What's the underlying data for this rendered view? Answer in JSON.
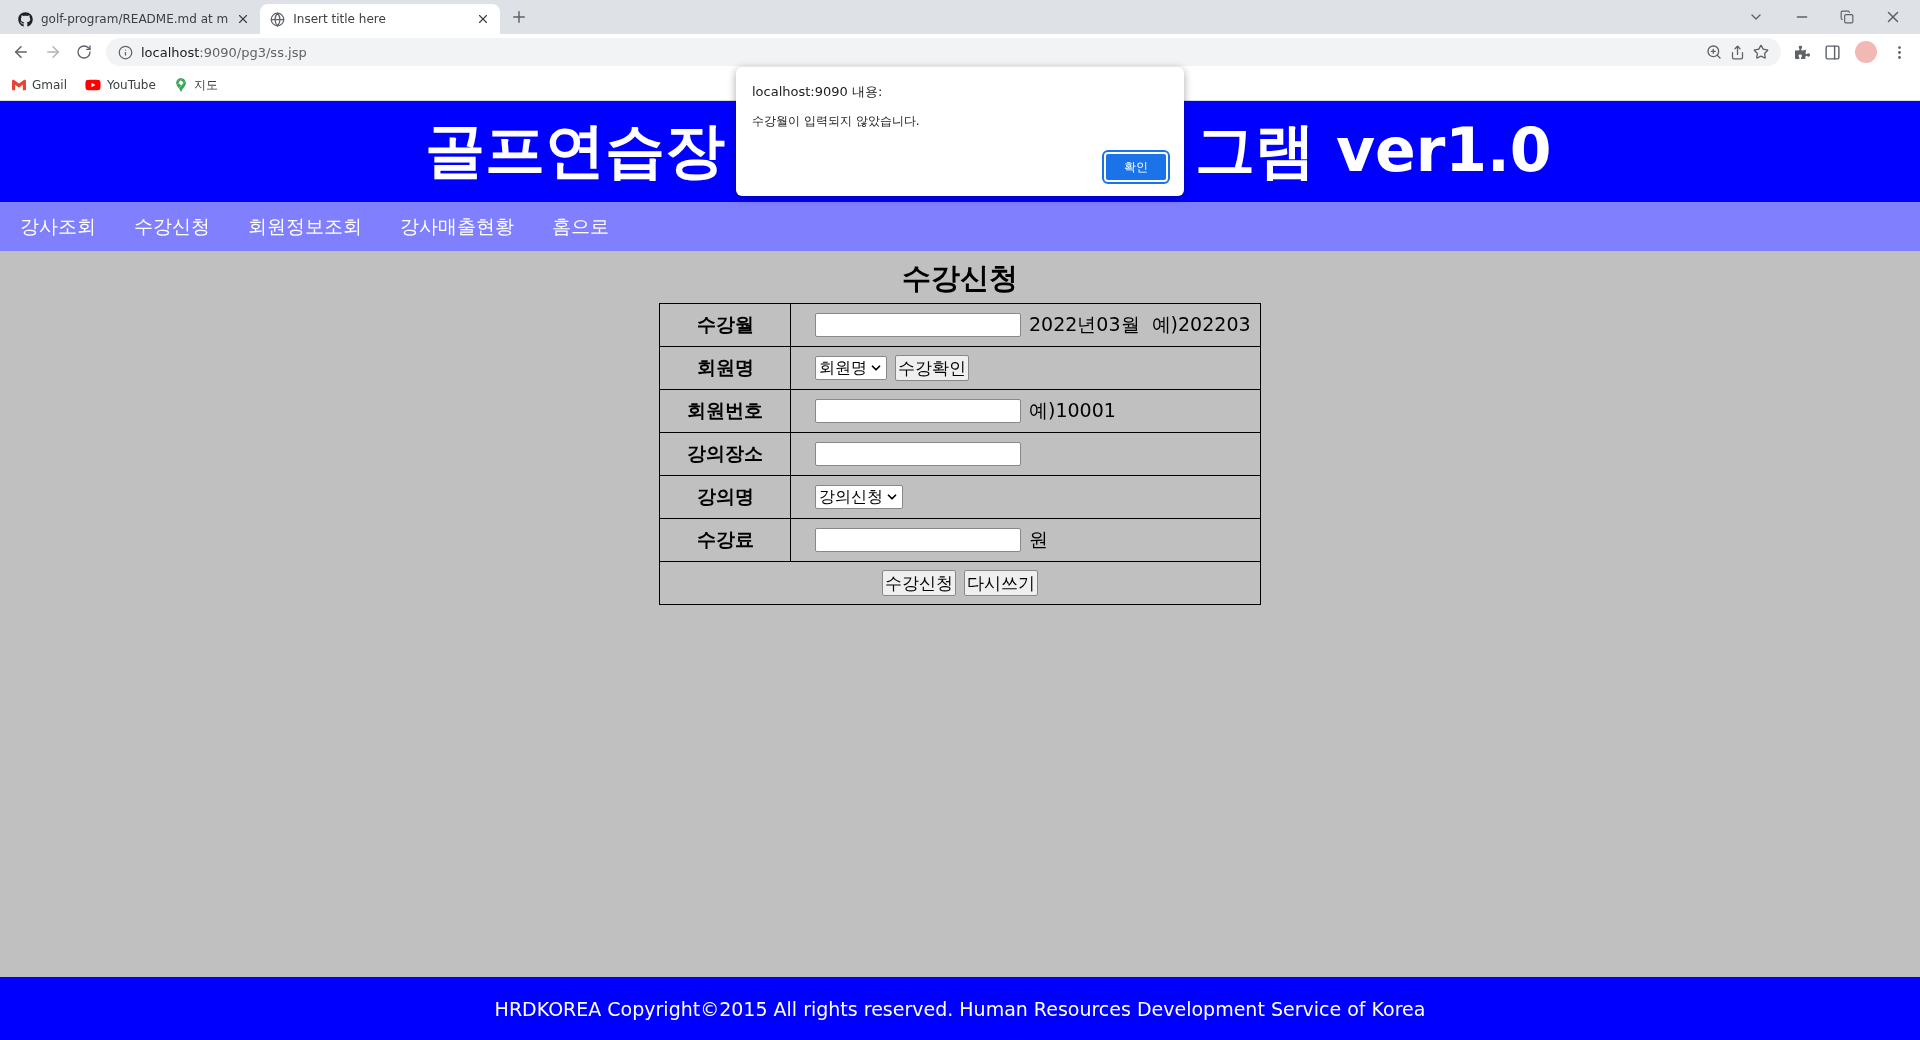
{
  "browser": {
    "tabs": [
      {
        "title": "golf-program/README.md at m",
        "selected": false
      },
      {
        "title": "Insert title here",
        "selected": true
      }
    ],
    "url_host": "localhost",
    "url_rest": ":9090/pg3/ss.jsp",
    "bookmarks": [
      "Gmail",
      "YouTube",
      "지도"
    ]
  },
  "header": {
    "title_left": "골프연습장",
    "title_right": "그램 ver1.0"
  },
  "nav": [
    "강사조회",
    "수강신청",
    "회원정보조회",
    "강사매출현황",
    "홈으로"
  ],
  "form": {
    "heading": "수강신청",
    "rows": [
      {
        "label": "수강월",
        "kind": "text",
        "note": "2022년03월  예)202203"
      },
      {
        "label": "회원명",
        "kind": "select_button",
        "select": "회원명",
        "button": "수강확인"
      },
      {
        "label": "회원번호",
        "kind": "text",
        "note": "예)10001"
      },
      {
        "label": "강의장소",
        "kind": "text"
      },
      {
        "label": "강의명",
        "kind": "select",
        "select": "강의신청"
      },
      {
        "label": "수강료",
        "kind": "text",
        "note": "원"
      }
    ],
    "buttons": [
      "수강신청",
      "다시쓰기"
    ]
  },
  "dialog": {
    "title": "localhost:9090 내용:",
    "message": "수강월이 입력되지 않았습니다.",
    "ok": "확인"
  },
  "footer": "HRDKOREA Copyright©2015 All rights reserved. Human Resources Development Service of Korea"
}
